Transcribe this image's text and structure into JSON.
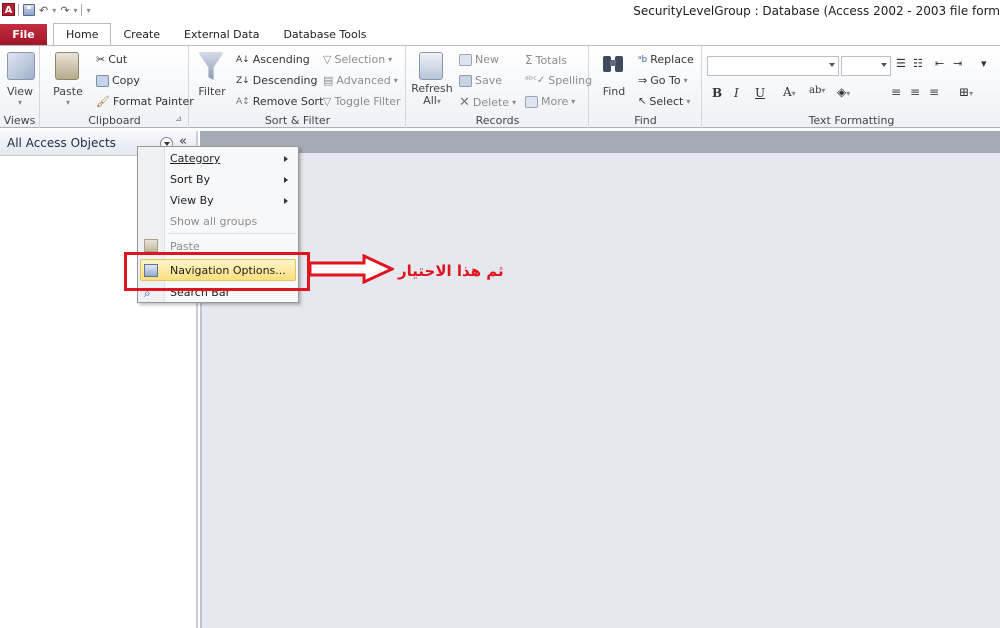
{
  "app": {
    "icon_letter": "A",
    "window_title": "SecurityLevelGroup : Database (Access 2002 - 2003 file form"
  },
  "tabs": {
    "file": "File",
    "items": [
      "Home",
      "Create",
      "External Data",
      "Database Tools"
    ]
  },
  "ribbon": {
    "views": {
      "view": "View",
      "label": "Views"
    },
    "clipboard": {
      "paste": "Paste",
      "cut": "Cut",
      "copy": "Copy",
      "format_painter": "Format Painter",
      "label": "Clipboard"
    },
    "sort_filter": {
      "filter": "Filter",
      "ascending": "Ascending",
      "descending": "Descending",
      "remove_sort": "Remove Sort",
      "selection": "Selection",
      "advanced": "Advanced",
      "toggle_filter": "Toggle Filter",
      "label": "Sort & Filter"
    },
    "records": {
      "refresh": "Refresh",
      "refresh_all": "All",
      "new": "New",
      "save": "Save",
      "delete": "Delete",
      "totals": "Totals",
      "spelling": "Spelling",
      "more": "More",
      "label": "Records"
    },
    "find": {
      "find": "Find",
      "replace": "Replace",
      "go_to": "Go To",
      "select": "Select",
      "label": "Find"
    },
    "text_formatting": {
      "label": "Text Formatting",
      "bold": "B",
      "italic": "I",
      "underline": "U"
    }
  },
  "nav_pane": {
    "title": "All Access Objects",
    "collapse": "«"
  },
  "context_menu": {
    "items": [
      {
        "label": "Category",
        "enabled": true,
        "submenu": true
      },
      {
        "label": "Sort By",
        "enabled": true,
        "submenu": true
      },
      {
        "label": "View By",
        "enabled": true,
        "submenu": true
      },
      {
        "label": "Show all groups",
        "enabled": false,
        "submenu": false
      },
      {
        "label": "Paste",
        "enabled": false,
        "submenu": false
      },
      {
        "label": "Navigation Options...",
        "enabled": true,
        "submenu": false,
        "highlighted": true
      },
      {
        "label": "Search Bar",
        "enabled": true,
        "submenu": false
      }
    ]
  },
  "annotation": {
    "text": "ثم هذا الاحتيار",
    "color": "#e0141d"
  },
  "colors": {
    "file_tab": "#b21d2f",
    "highlight": "#fbdf7d",
    "workspace": "#e5e8ee"
  }
}
